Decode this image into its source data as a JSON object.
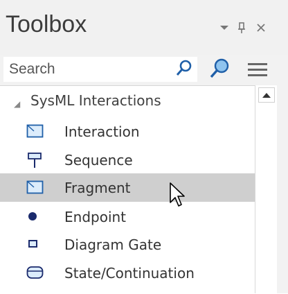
{
  "window": {
    "title": "Toolbox",
    "controls": {
      "dropdown_icon": "chevron-down-icon",
      "pin_icon": "pin-icon",
      "close_icon": "close-icon",
      "dropdown_glyph": "▾",
      "pin_glyph": "ꟷ",
      "close_glyph": "×"
    }
  },
  "search": {
    "placeholder": "Search",
    "find_icon": "search-icon",
    "find_advanced_icon": "advanced-search-icon",
    "menu_icon": "hamburger-menu-icon"
  },
  "toolbox": {
    "group": {
      "label": "SysML Interactions",
      "expanded": true,
      "items": [
        {
          "label": "Interaction",
          "icon": "interaction-icon",
          "selected": false
        },
        {
          "label": "Sequence",
          "icon": "sequence-icon",
          "selected": false
        },
        {
          "label": "Fragment",
          "icon": "fragment-icon",
          "selected": true
        },
        {
          "label": "Endpoint",
          "icon": "endpoint-icon",
          "selected": false
        },
        {
          "label": "Diagram Gate",
          "icon": "diagram-gate-icon",
          "selected": false
        },
        {
          "label": "State/Continuation",
          "icon": "state-continuation-icon",
          "selected": false
        }
      ]
    }
  },
  "colors": {
    "selection": "#cfcfcf",
    "icon_blue": "#1f5fa8",
    "icon_navy": "#1a2a6c"
  }
}
